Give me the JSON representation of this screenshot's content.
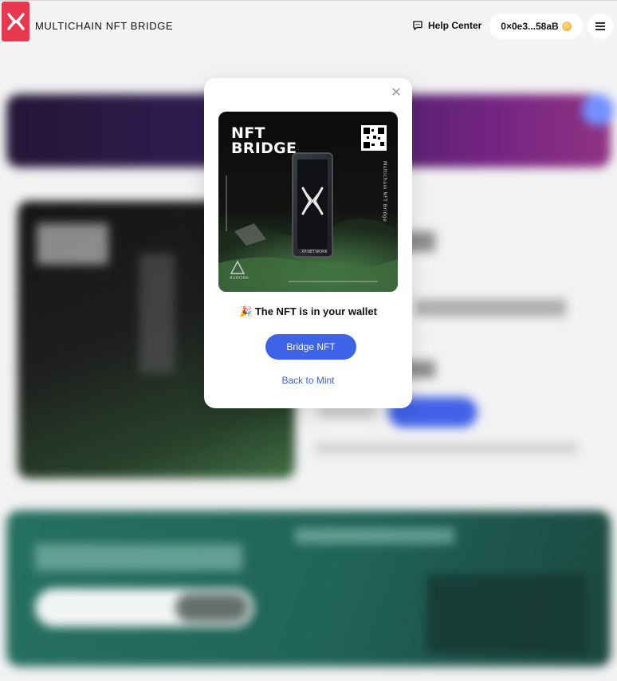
{
  "header": {
    "brand": "MULTICHAIN NFT BRIDGE",
    "help_label": "Help Center",
    "wallet_address": "0×0e3...58aB",
    "accent": "#e8384d"
  },
  "modal": {
    "image": {
      "heading_line1": "NFT",
      "heading_line2": "BRIDGE",
      "vertical_text": "Multichain NFT Bridge",
      "card_text": "XP.NETWORK",
      "brand_text": "AURORA"
    },
    "message": "🎉 The NFT is in your wallet",
    "bridge_button": "Bridge NFT",
    "back_link": "Back to Mint",
    "button_color": "#3d63e6"
  }
}
